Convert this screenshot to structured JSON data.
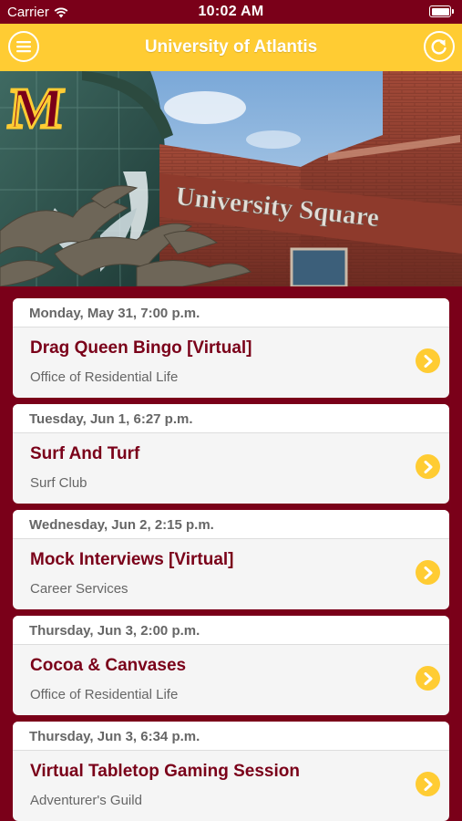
{
  "status_bar": {
    "carrier": "Carrier",
    "time": "10:02 AM"
  },
  "nav": {
    "title": "University of Atlantis",
    "left_icon": "menu-icon",
    "right_icon": "refresh-icon"
  },
  "hero": {
    "logo_text": "M",
    "sign_text": "University Square"
  },
  "colors": {
    "maroon": "#7a0019",
    "gold": "#ffcc33"
  },
  "events": [
    {
      "date": "Monday, May 31, 7:00 p.m.",
      "title": "Drag Queen Bingo [Virtual]",
      "organizer": "Office of Residential Life"
    },
    {
      "date": "Tuesday, Jun 1, 6:27 p.m.",
      "title": "Surf And Turf",
      "organizer": "Surf Club"
    },
    {
      "date": "Wednesday, Jun 2, 2:15 p.m.",
      "title": "Mock Interviews [Virtual]",
      "organizer": "Career Services"
    },
    {
      "date": "Thursday, Jun 3, 2:00 p.m.",
      "title": "Cocoa & Canvases",
      "organizer": "Office of Residential Life"
    },
    {
      "date": "Thursday, Jun 3, 6:34 p.m.",
      "title": "Virtual Tabletop Gaming Session",
      "organizer": "Adventurer's Guild"
    }
  ]
}
